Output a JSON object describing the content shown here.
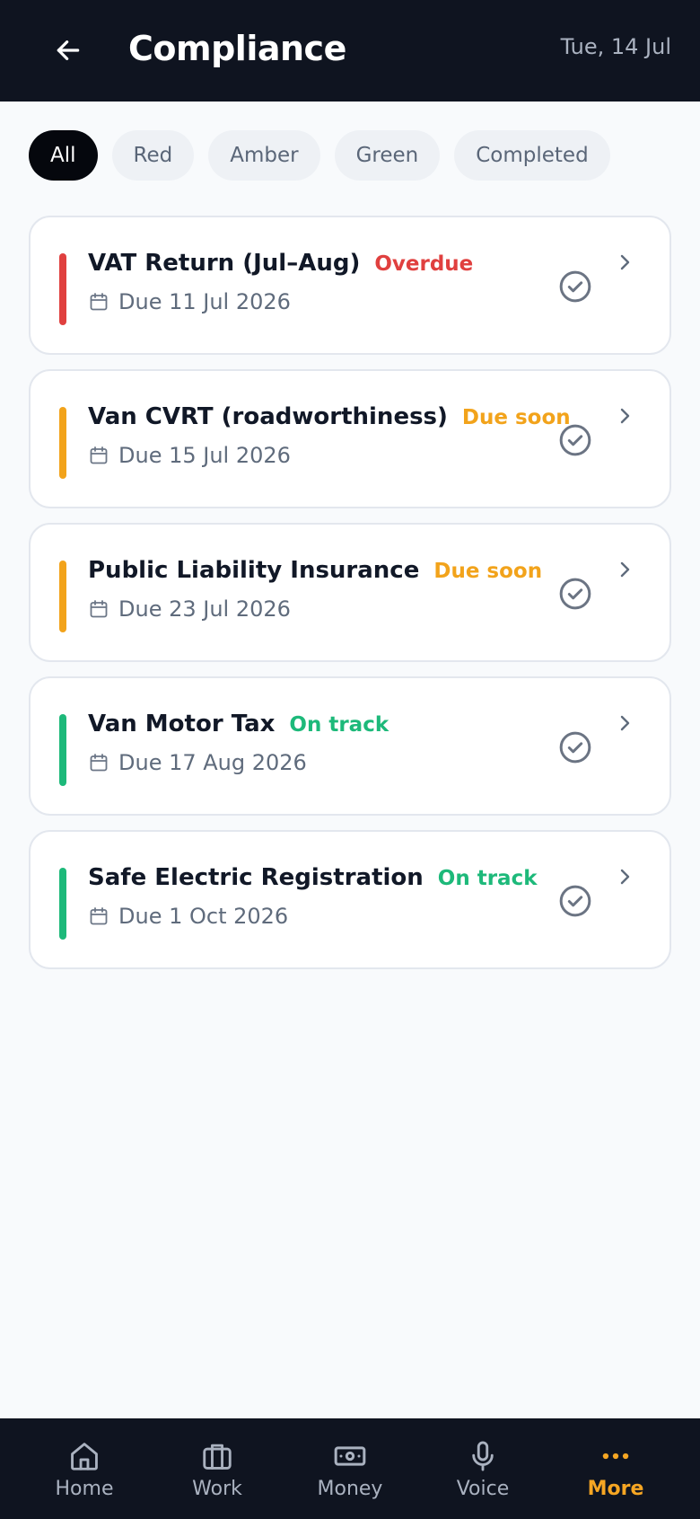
{
  "header": {
    "title": "Compliance",
    "date": "Tue, 14 Jul"
  },
  "filters": [
    {
      "label": "All",
      "active": true
    },
    {
      "label": "Red",
      "active": false
    },
    {
      "label": "Amber",
      "active": false
    },
    {
      "label": "Green",
      "active": false
    },
    {
      "label": "Completed",
      "active": false
    }
  ],
  "items": [
    {
      "title": "VAT Return (Jul–Aug)",
      "status": "Overdue",
      "status_color": "#e0403f",
      "due": "Due 11 Jul 2026"
    },
    {
      "title": "Van CVRT (roadworthiness)",
      "status": "Due soon",
      "status_color": "#f2a31b",
      "due": "Due 15 Jul 2026"
    },
    {
      "title": "Public Liability Insurance",
      "status": "Due soon",
      "status_color": "#f2a31b",
      "due": "Due 23 Jul 2026"
    },
    {
      "title": "Van Motor Tax",
      "status": "On track",
      "status_color": "#1db97a",
      "due": "Due 17 Aug 2026"
    },
    {
      "title": "Safe Electric Registration",
      "status": "On track",
      "status_color": "#1db97a",
      "due": "Due 1 Oct 2026"
    }
  ],
  "bottom_nav": [
    {
      "label": "Home",
      "icon": "home-icon",
      "active": false
    },
    {
      "label": "Work",
      "icon": "briefcase-icon",
      "active": false
    },
    {
      "label": "Money",
      "icon": "banknote-icon",
      "active": false
    },
    {
      "label": "Voice",
      "icon": "microphone-icon",
      "active": false
    },
    {
      "label": "More",
      "icon": "more-dots-icon",
      "active": true
    }
  ],
  "colors": {
    "header_bg": "#0f1420",
    "accent": "#f6a623"
  }
}
